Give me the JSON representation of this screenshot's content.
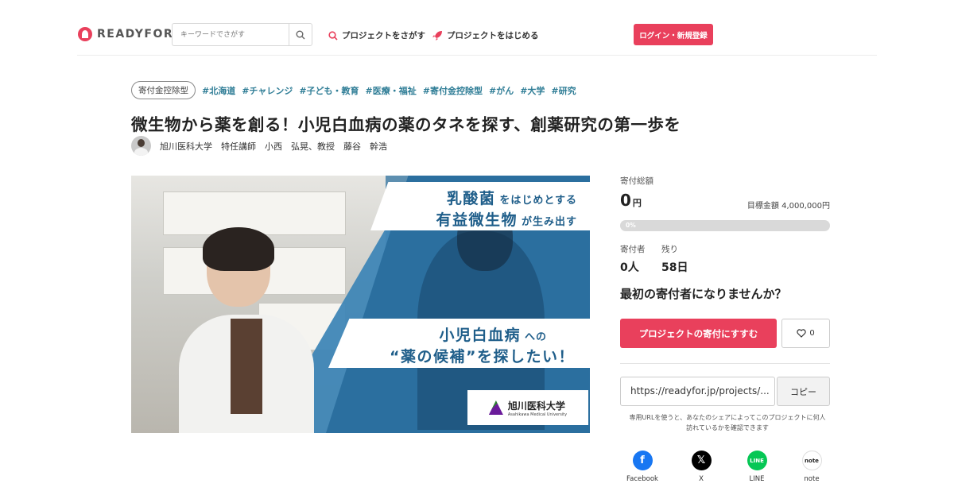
{
  "header": {
    "logo": "READYFOR",
    "search_placeholder": "キーワードでさがす",
    "nav_find": "プロジェクトをさがす",
    "nav_start": "プロジェクトをはじめる",
    "login": "ログイン・新規登録"
  },
  "project": {
    "badge": "寄付金控除型",
    "tags": [
      "#北海道",
      "#チャレンジ",
      "#子ども・教育",
      "#医療・福祉",
      "#寄付金控除型",
      "#がん",
      "#大学",
      "#研究"
    ],
    "title": "微生物から薬を創る！小児白血病の薬のタネを探す、創薬研究の第一歩を",
    "author": "旭川医科大学　特任講師　小西　弘晃、教授　藤谷　幹浩"
  },
  "hero": {
    "line1_big": "乳酸菌",
    "line1_small": "をはじめとする",
    "line2_big": "有益微生物",
    "line2_small": "が生み出す",
    "line3_big": "小児白血病",
    "line3_small": "への",
    "line4": "“薬の候補”を探したい！",
    "uni_jp": "旭川医科大学",
    "uni_en": "Asahikawa Medical University"
  },
  "sidebar": {
    "total_label": "寄付総額",
    "total_value": "0",
    "total_unit": "円",
    "goal": "目標金額 4,000,000円",
    "progress_text": "0%",
    "progress_fraction": 0,
    "donors_label": "寄付者",
    "donors_value": "0人",
    "remaining_label": "残り",
    "remaining_value": "58日",
    "prompt": "最初の寄付者になりませんか？",
    "donate": "プロジェクトの寄付にすすむ",
    "fav_count": "0",
    "url": "https://readyfor.jp/projects/...",
    "copy": "コピー",
    "note": "専用URLを使うと、あなたのシェアによってこのプロジェクトに何人訪れているかを確認できます",
    "shares": [
      {
        "name": "Facebook",
        "icon": "facebook-icon",
        "color": "#1877f2"
      },
      {
        "name": "X",
        "icon": "x-icon",
        "color": "#000000"
      },
      {
        "name": "LINE",
        "icon": "line-icon",
        "color": "#06c755"
      },
      {
        "name": "note",
        "icon": "note-icon",
        "color": "#ffffff"
      }
    ]
  },
  "colors": {
    "accent": "#e9405c",
    "tag": "#2f7d96"
  }
}
